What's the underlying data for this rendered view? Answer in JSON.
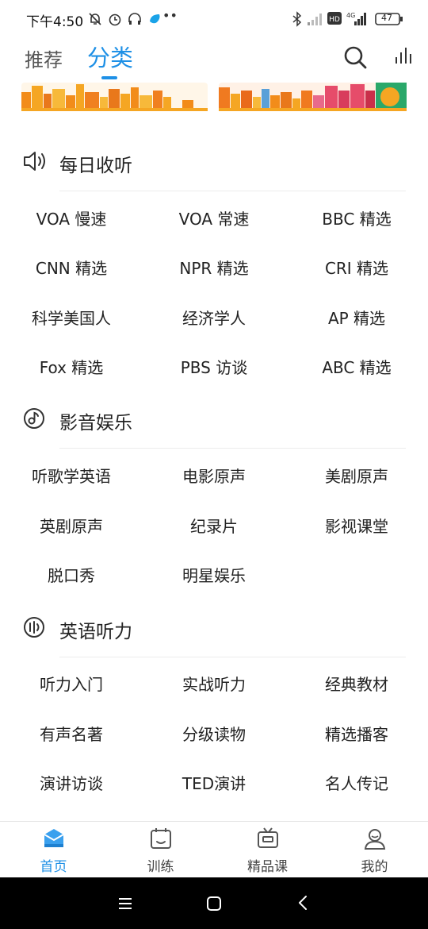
{
  "status": {
    "time": "下午4:50",
    "battery": "47"
  },
  "tabs": {
    "recommend": "推荐",
    "category": "分类"
  },
  "sections": [
    {
      "title": "每日收听",
      "icon": "speaker-icon",
      "items": [
        "VOA 慢速",
        "VOA 常速",
        "BBC 精选",
        "CNN 精选",
        "NPR 精选",
        "CRI 精选",
        "科学美国人",
        "经济学人",
        "AP 精选",
        "Fox 精选",
        "PBS 访谈",
        "ABC 精选"
      ]
    },
    {
      "title": "影音娱乐",
      "icon": "music-disc-icon",
      "items": [
        "听歌学英语",
        "电影原声",
        "美剧原声",
        "英剧原声",
        "纪录片",
        "影视课堂",
        "脱口秀",
        "明星娱乐"
      ]
    },
    {
      "title": "英语听力",
      "icon": "listening-icon",
      "items": [
        "听力入门",
        "实战听力",
        "经典教材",
        "有声名著",
        "分级读物",
        "精选播客",
        "演讲访谈",
        "TED演讲",
        "名人传记"
      ]
    }
  ],
  "nav": {
    "home": "首页",
    "train": "训练",
    "premium": "精品课",
    "mine": "我的"
  },
  "colors": {
    "accent": "#1e90e6",
    "banner_orange": "#f39a1f"
  }
}
